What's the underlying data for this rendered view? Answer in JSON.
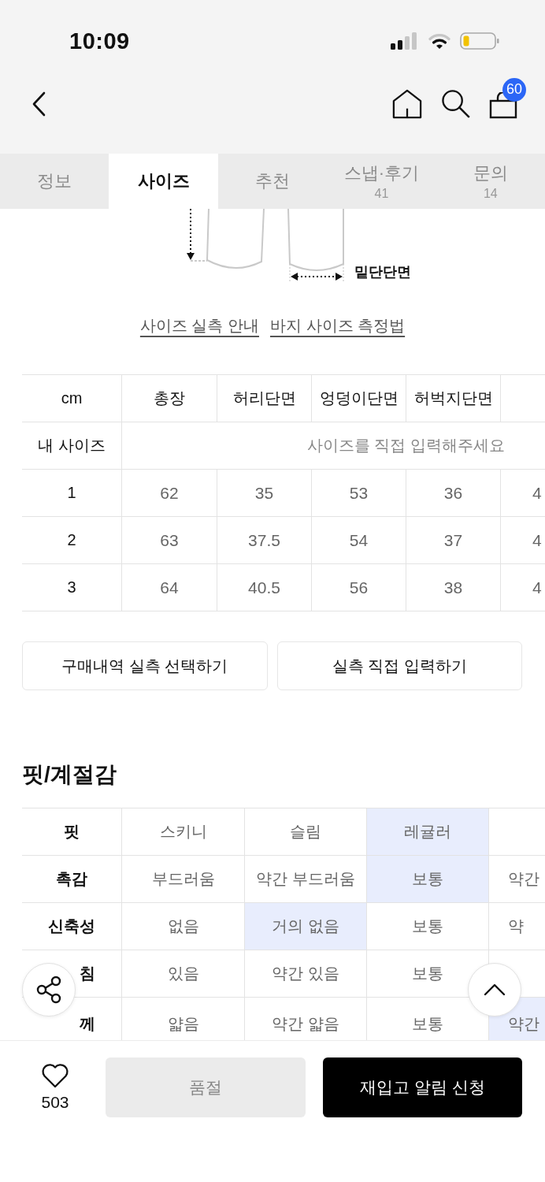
{
  "status_bar": {
    "time": "10:09"
  },
  "nav": {
    "cart_count": "60"
  },
  "tabs": [
    {
      "label": "정보",
      "selected": false
    },
    {
      "label": "사이즈",
      "selected": true
    },
    {
      "label": "추천",
      "selected": false
    },
    {
      "label": "스냅·후기",
      "count": "41",
      "selected": false
    },
    {
      "label": "문의",
      "count": "14",
      "selected": false
    }
  ],
  "diagram": {
    "label": "밑단단면"
  },
  "guide_links": [
    "사이즈 실측 안내",
    "바지 사이즈 측정법"
  ],
  "size_table": {
    "columns": [
      "cm",
      "총장",
      "허리단면",
      "엉덩이단면",
      "허벅지단면"
    ],
    "my_size": {
      "label": "내 사이즈",
      "prompt": "사이즈를 직접 입력해주세요"
    },
    "rows": [
      {
        "label": "1",
        "values": [
          "62",
          "35",
          "53",
          "36",
          "4"
        ]
      },
      {
        "label": "2",
        "values": [
          "63",
          "37.5",
          "54",
          "37",
          "4"
        ]
      },
      {
        "label": "3",
        "values": [
          "64",
          "40.5",
          "56",
          "38",
          "4"
        ]
      }
    ]
  },
  "size_buttons": [
    "구매내역 실측 선택하기",
    "실측 직접 입력하기"
  ],
  "fit": {
    "title": "핏/계절감",
    "rows": [
      {
        "label": "핏",
        "options": [
          {
            "text": "스키니",
            "selected": false
          },
          {
            "text": "슬림",
            "selected": false
          },
          {
            "text": "레귤러",
            "selected": true
          }
        ]
      },
      {
        "label": "촉감",
        "options": [
          {
            "text": "부드러움",
            "selected": false
          },
          {
            "text": "약간 부드러움",
            "selected": false
          },
          {
            "text": "보통",
            "selected": true
          },
          {
            "text": "약간",
            "selected": false
          }
        ]
      },
      {
        "label": "신축성",
        "options": [
          {
            "text": "없음",
            "selected": false
          },
          {
            "text": "거의 없음",
            "selected": true
          },
          {
            "text": "보통",
            "selected": false
          },
          {
            "text": "약",
            "selected": false
          }
        ]
      },
      {
        "label": "침",
        "options": [
          {
            "text": "있음",
            "selected": false
          },
          {
            "text": "약간 있음",
            "selected": false
          },
          {
            "text": "보통",
            "selected": false
          }
        ]
      },
      {
        "label": "께",
        "options": [
          {
            "text": "얇음",
            "selected": false
          },
          {
            "text": "약간 얇음",
            "selected": false
          },
          {
            "text": "보통",
            "selected": false
          },
          {
            "text": "약간",
            "selected": true
          }
        ]
      }
    ]
  },
  "bottom_bar": {
    "likes": "503",
    "sold_out": {
      "label": "품절",
      "disabled": true
    },
    "restock": {
      "label": "재입고 알림 신청"
    }
  }
}
